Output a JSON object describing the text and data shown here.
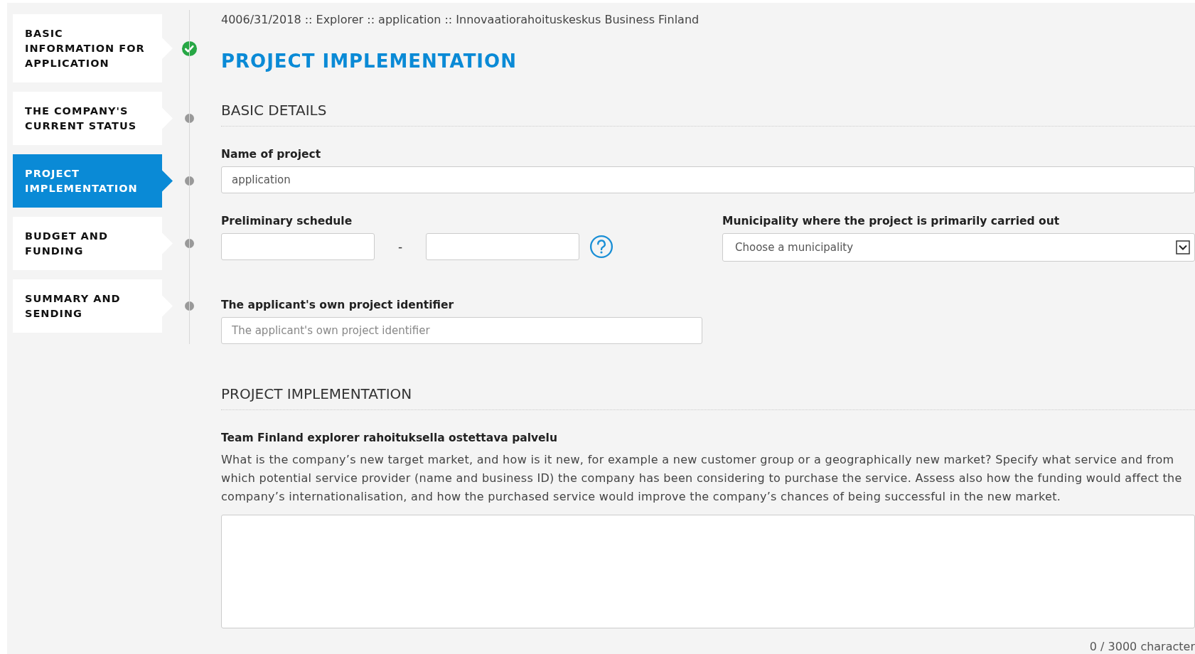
{
  "steps": [
    {
      "label": "BASIC INFORMATION FOR APPLICATION",
      "selected": false,
      "completed": true
    },
    {
      "label": "THE COMPANY'S CURRENT STATUS",
      "selected": false,
      "completed": false
    },
    {
      "label": "PROJECT IMPLEMENTATION",
      "selected": true,
      "completed": false
    },
    {
      "label": "BUDGET AND FUNDING",
      "selected": false,
      "completed": false
    },
    {
      "label": "SUMMARY AND SENDING",
      "selected": false,
      "completed": false
    }
  ],
  "breadcrumb": "4006/31/2018 :: Explorer :: application :: Innovaatiorahoituskeskus Business Finland",
  "page_title": "PROJECT IMPLEMENTATION",
  "basic_details": {
    "heading": "BASIC DETAILS",
    "name_of_project": {
      "label": "Name of project",
      "value": "application"
    },
    "schedule": {
      "label": "Preliminary schedule",
      "separator": "-"
    },
    "municipality": {
      "label": "Municipality where the project is primarily carried out",
      "value": "Choose a municipality"
    },
    "identifier": {
      "label": "The applicant's own project identifier",
      "placeholder": "The applicant's own project identifier"
    }
  },
  "implementation": {
    "heading": "PROJECT IMPLEMENTATION",
    "question_label": "Team Finland explorer rahoituksella ostettava palvelu",
    "question_text": "What is the company’s new target market, and how is it new, for example a new customer group or a geographically new market? Specify what service and from which potential service provider (name and business ID) the company has been considering to purchase the service. Assess also how the funding would affect the company’s internationalisation, and how the purchased service would improve the company’s chances of being successful in the new market.",
    "counter": "0 / 3000 character"
  }
}
